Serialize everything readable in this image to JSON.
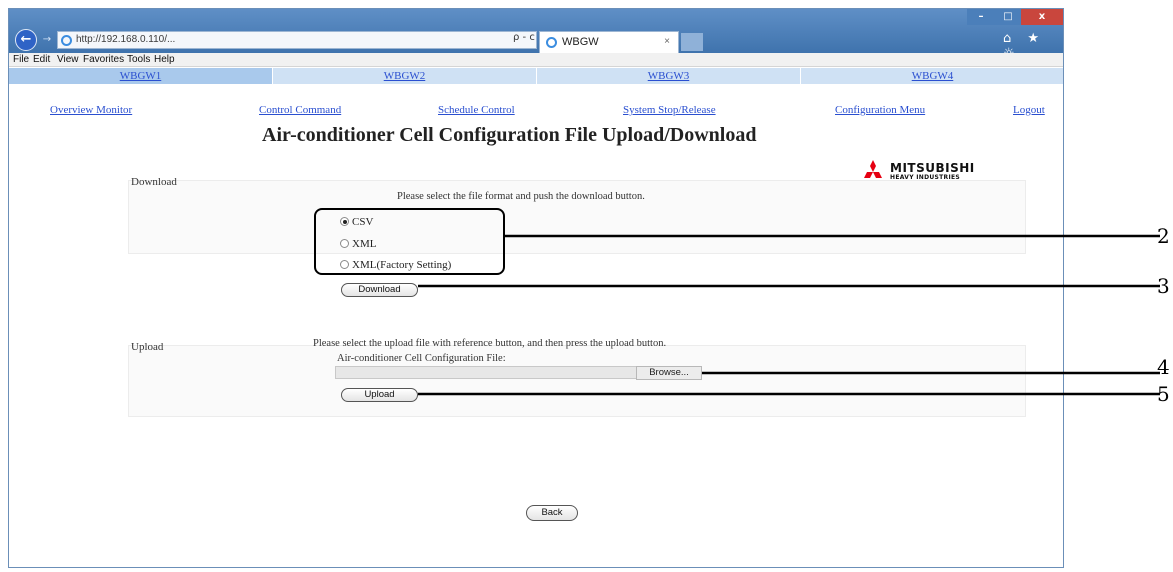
{
  "browser": {
    "address": "http://192.168.0.110/...",
    "tab_title": "WBGW",
    "address_tools": "ρ - c",
    "win_min": "–",
    "win_max": "□",
    "win_close": "x",
    "right_icons": "⌂ ★ ☼",
    "menu": [
      "File",
      "Edit",
      "View",
      "Favorites",
      "Tools",
      "Help"
    ]
  },
  "gateway_tabs": [
    "WBGW1",
    "WBGW2",
    "WBGW3",
    "WBGW4"
  ],
  "nav_links": [
    "Overview Monitor",
    "Control Command",
    "Schedule Control",
    "System Stop/Release",
    "Configuration Menu",
    "Logout"
  ],
  "page_title": "Air-conditioner Cell Configuration File Upload/Download",
  "logo": {
    "name": "MITSUBISHI",
    "sub": "HEAVY INDUSTRIES"
  },
  "download": {
    "label": "Download",
    "instruction": "Please select the file format and push the download button.",
    "options": [
      "CSV",
      "XML",
      "XML(Factory Setting)"
    ],
    "selected": "CSV",
    "button": "Download"
  },
  "upload": {
    "label": "Upload",
    "instruction": "Please select the upload file with reference button, and then press the upload button.",
    "file_label": "Air-conditioner Cell Configuration File:",
    "browse_button": "Browse...",
    "button": "Upload"
  },
  "back_button": "Back",
  "callouts": [
    "2",
    "3",
    "4",
    "5"
  ]
}
